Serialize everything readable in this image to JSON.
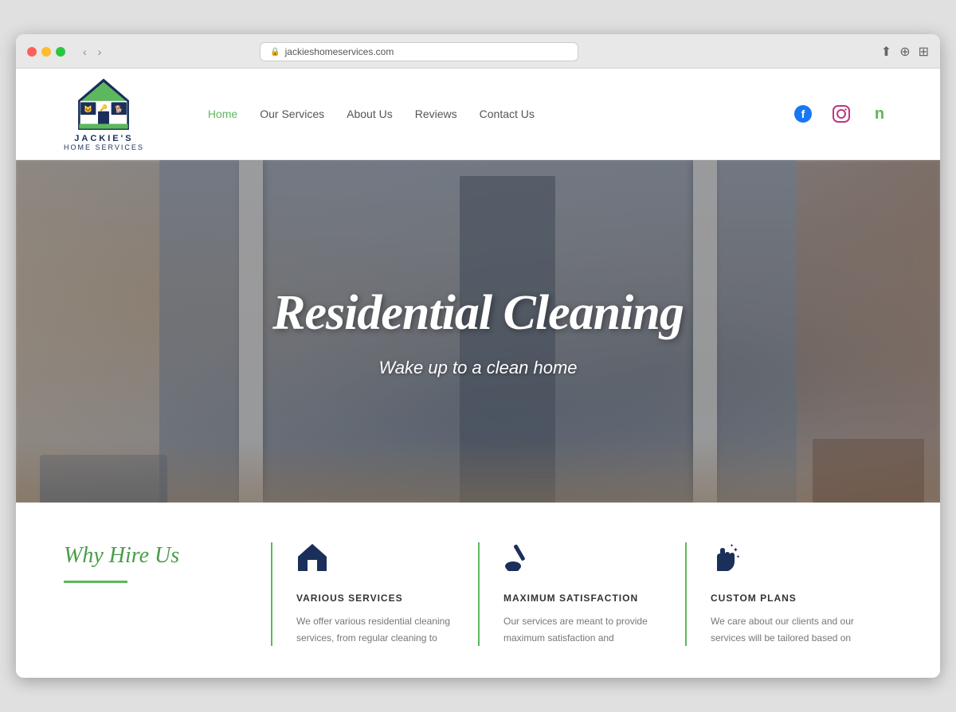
{
  "browser": {
    "url": "jackieshomeservices.com",
    "reload_btn": "⟳"
  },
  "site": {
    "title": "Jackie's Home Services",
    "logo_tagline": "JACKIE'S",
    "logo_subtitle": "HOME SERVICES"
  },
  "nav": {
    "items": [
      {
        "label": "Home",
        "active": true
      },
      {
        "label": "Our Services",
        "active": false
      },
      {
        "label": "About Us",
        "active": false
      },
      {
        "label": "Reviews",
        "active": false
      },
      {
        "label": "Contact Us",
        "active": false
      }
    ]
  },
  "social": {
    "facebook_label": "f",
    "instagram_label": "◉",
    "nextdoor_label": "ñ"
  },
  "hero": {
    "title": "Residential Cleaning",
    "subtitle": "Wake up to a clean home"
  },
  "services": {
    "section_title": "Why Hire Us",
    "items": [
      {
        "name": "VARIOUS SERVICES",
        "desc": "We offer various residential cleaning services, from regular cleaning to",
        "icon": "🏠"
      },
      {
        "name": "MAXIMUM SATISFACTION",
        "desc": "Our services are meant to provide maximum satisfaction and",
        "icon": "🧹"
      },
      {
        "name": "CUSTOM PLANS",
        "desc": "We care about our clients and our services will be tailored based on",
        "icon": "✋"
      }
    ]
  }
}
